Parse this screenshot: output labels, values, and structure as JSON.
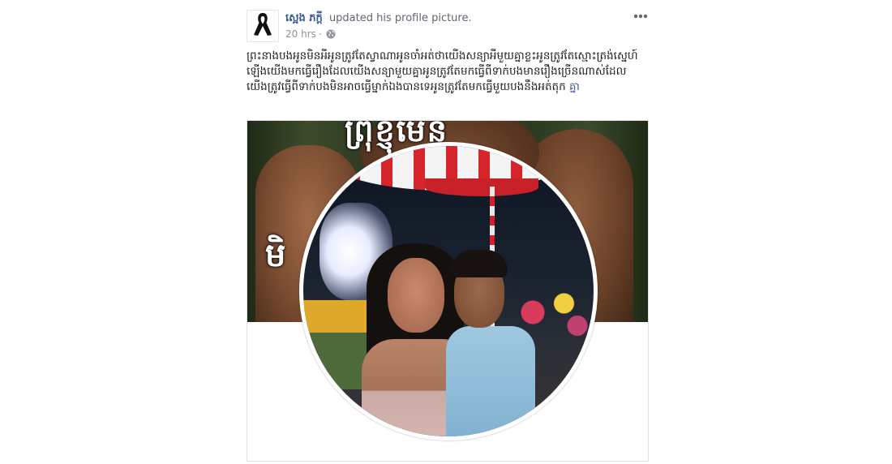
{
  "post": {
    "author": "ស្អេង ភក្តី",
    "action": "updated his profile picture.",
    "time": "20 hrs",
    "separator": "·",
    "privacy_icon": "globe-icon",
    "more_icon": "more-options-icon",
    "caption": "ព្រះនាងបងអូនមិនអីអូនត្រូវតែស្វាណាអូនចាំអត់ថាយើងសន្យាអីមួយគ្នាខ្លះអូនត្រូវតែស្មោះត្រង់ស្នេហ៍ឡើងយើងមកធ្វើរឿងដែលយើងសន្យាមួយគ្នាអូនត្រូវតែមកធ្វើពីទាក់បងមានរឿងច្រើនណាស់ដែលយើងត្រូវធ្វើពីទាក់បងមិនអាចធ្វើម្នាក់ឯងបានទេអូនត្រូវតែមកធ្វើមួយបងនឹងអត់តុក",
    "caption_link": "គ្នា"
  },
  "cover_photo": {
    "text_top": "ព្រុំខ្ញុំមែន",
    "text_left": "មិ"
  },
  "colors": {
    "author_link": "#385898",
    "meta_text": "#90949c",
    "body_text": "#1c1e21"
  }
}
